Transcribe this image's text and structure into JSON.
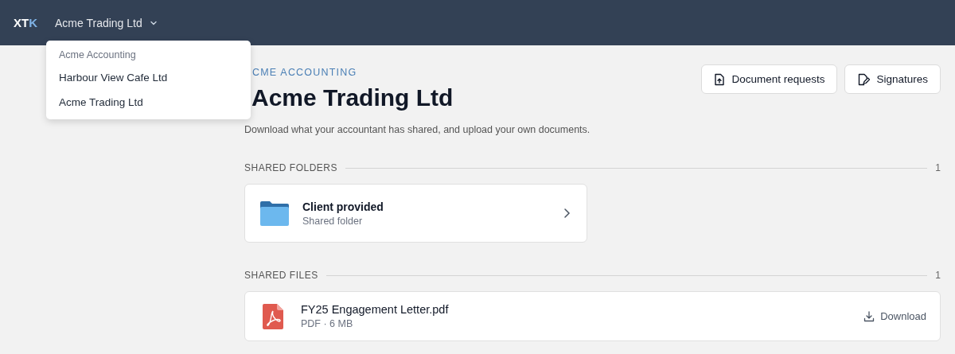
{
  "top_bar": {
    "logo": [
      {
        "text": "XT",
        "accent": false
      },
      {
        "text": "K",
        "accent": true
      }
    ],
    "org_switcher": {
      "label": "Acme Trading Ltd",
      "expanded": true
    }
  },
  "org_menu": {
    "group_label": "Acme Accounting",
    "items": [
      {
        "label": "Harbour View Cafe Ltd"
      },
      {
        "label": "Acme Trading Ltd"
      }
    ]
  },
  "page": {
    "eyebrow": "CME ACCOUNTING",
    "title": "Acme Trading Ltd",
    "subtitle": "Download what your accountant has shared, and upload your own documents.",
    "actions": [
      {
        "kind": "upload",
        "label": "Document requests"
      },
      {
        "kind": "sign",
        "label": "Signatures"
      }
    ]
  },
  "shared_folders": {
    "heading": "SHARED FOLDERS",
    "count": "1",
    "items": [
      {
        "name": "Client provided",
        "subtitle": "Shared folder"
      }
    ]
  },
  "shared_files": {
    "heading": "SHARED FILES",
    "count": "1",
    "items": [
      {
        "name": "FY25 Engagement Letter.pdf",
        "meta": "PDF · 6 MB",
        "action": "Download"
      }
    ]
  }
}
